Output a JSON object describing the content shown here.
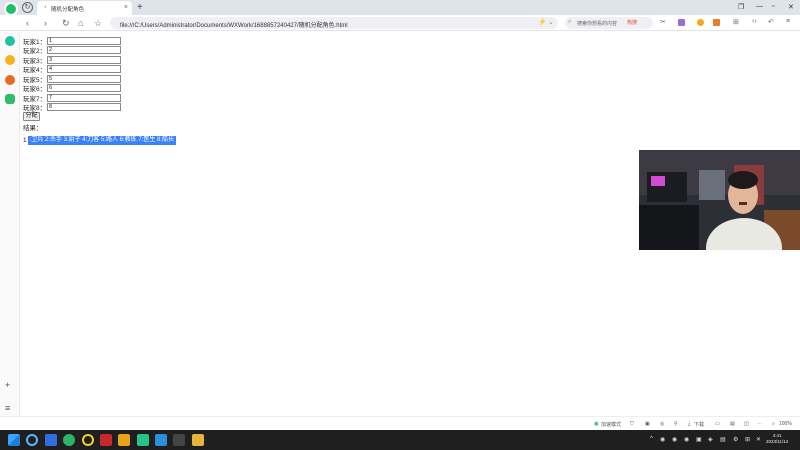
{
  "browser": {
    "logo_text": "360极速浏览器",
    "tab_title": "随机分配角色",
    "url": "file:///C:/Users/Administrator/Documents/WXWork/1688857240427/随机分配角色.html",
    "search_placeholder": "搜索你想看的内容",
    "hot_label": "热搜"
  },
  "form": {
    "fields": [
      {
        "label": "玩家1：",
        "value": "1"
      },
      {
        "label": "玩家2：",
        "value": "2"
      },
      {
        "label": "玩家3：",
        "value": "3"
      },
      {
        "label": "玩家4：",
        "value": "4"
      },
      {
        "label": "玩家5：",
        "value": "5"
      },
      {
        "label": "玩家6：",
        "value": "6"
      },
      {
        "label": "玩家7：",
        "value": "7"
      },
      {
        "label": "玩家8：",
        "value": "8"
      }
    ],
    "assign_button": "分配",
    "result_label": "结果："
  },
  "result": {
    "prefix": "1",
    "text": ":卫兵 2:杀手 3:厨子 4:刀客 5:路人 6:教练 7:医生 8:船长"
  },
  "statusbar": {
    "speedup": "加速模式",
    "download": "下载",
    "zoom": "100%"
  },
  "taskbar": {
    "time": "4:41",
    "date": "2023/11/14"
  },
  "colors": {
    "selection": "#3b82f6",
    "taskbar": "#1f1f1f"
  }
}
